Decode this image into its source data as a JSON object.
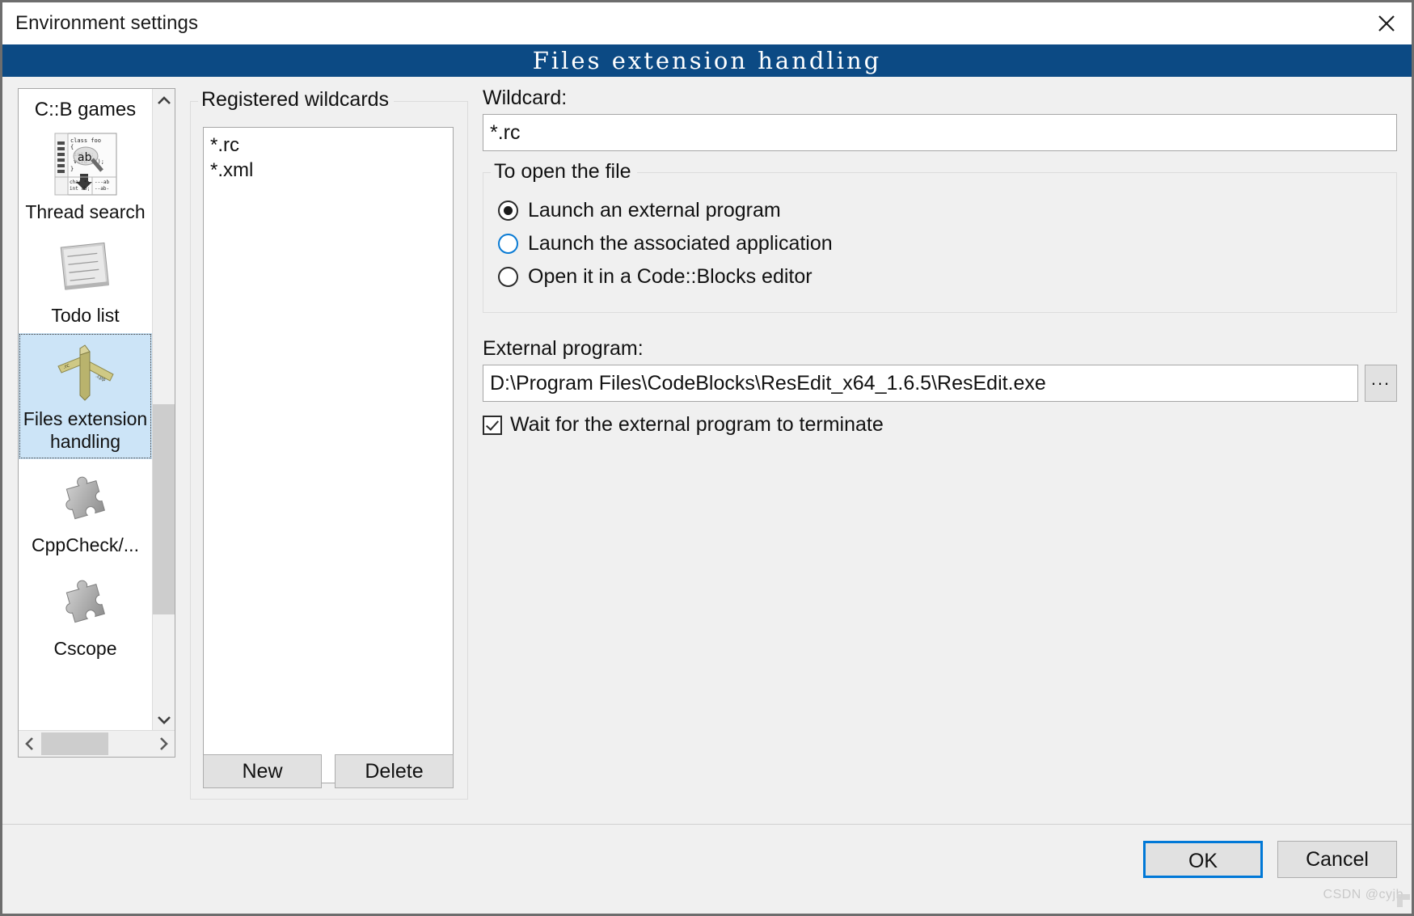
{
  "window": {
    "title": "Environment settings",
    "close_icon": "close-icon",
    "header_title": "Files extension handling"
  },
  "sidebar": {
    "group_title": "C::B games",
    "items": [
      {
        "label": "Thread search",
        "icon": "thread-search-icon",
        "selected": false
      },
      {
        "label": "Todo list",
        "icon": "todo-list-icon",
        "selected": false
      },
      {
        "label": "Files extension handling",
        "icon": "files-extension-handling-icon",
        "selected": true
      },
      {
        "label": "CppCheck/...",
        "icon": "puzzle-piece-icon",
        "selected": false
      },
      {
        "label": "Cscope",
        "icon": "puzzle-piece-icon",
        "selected": false
      }
    ],
    "scroll_up_icon": "chevron-up-icon",
    "scroll_down_icon": "chevron-down-icon",
    "scroll_left_icon": "chevron-left-icon",
    "scroll_right_icon": "chevron-right-icon"
  },
  "wildcards": {
    "legend": "Registered wildcards",
    "items": [
      "*.rc",
      "*.xml"
    ],
    "new_label": "New",
    "delete_label": "Delete"
  },
  "wildcard_field": {
    "label": "Wildcard:",
    "value": "*.rc"
  },
  "open_group": {
    "legend": "To open the file",
    "options": [
      {
        "label": "Launch an external program",
        "checked": true,
        "hover": false
      },
      {
        "label": "Launch the associated application",
        "checked": false,
        "hover": true
      },
      {
        "label": "Open it in a Code::Blocks editor",
        "checked": false,
        "hover": false
      }
    ]
  },
  "external_program": {
    "label": "External program:",
    "value": "D:\\Program Files\\CodeBlocks\\ResEdit_x64_1.6.5\\ResEdit.exe",
    "browse_label": "...",
    "wait_checkbox": {
      "label": "Wait for the external program to terminate",
      "checked": true
    }
  },
  "footer": {
    "ok_label": "OK",
    "cancel_label": "Cancel"
  },
  "watermark": "CSDN @cyjb",
  "colors": {
    "header_blue": "#0c4a84",
    "selection_blue": "#cce4f7",
    "focus_blue": "#0078d7",
    "hover_blue": "#0a7bd4",
    "dialog_bg": "#f0f0f0"
  }
}
